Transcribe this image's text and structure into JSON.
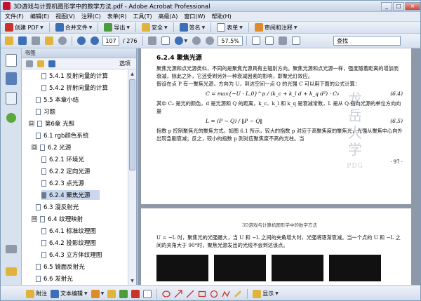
{
  "window": {
    "title": "3D游戏与计算机图形学中的数学方法.pdf - Adobe Acrobat Professional",
    "min": "_",
    "max": "□",
    "close": "×"
  },
  "menu": [
    "文件(F)",
    "编辑(E)",
    "视图(V)",
    "注释(C)",
    "表单(R)",
    "工具(T)",
    "高级(A)",
    "窗口(W)",
    "帮助(H)"
  ],
  "toolbar1": {
    "create_pdf": "创建 PDF",
    "combine": "合并文件",
    "export": "导出",
    "secure": "安全",
    "sign": "签名",
    "forms": "表单",
    "review": "审阅和注释"
  },
  "toolbar2": {
    "page_current": "107",
    "page_total": "/ 276",
    "zoom": "57.5%",
    "find_placeholder": "查找"
  },
  "panel": {
    "title": "书签",
    "options": "选项"
  },
  "tree": [
    {
      "label": "5.4.1 反射向量的计算",
      "level": 3,
      "type": "page"
    },
    {
      "label": "5.4.2 折射向量的计算",
      "level": 3,
      "type": "page"
    },
    {
      "label": "5.5 本章小结",
      "level": 2,
      "type": "page"
    },
    {
      "label": "习题",
      "level": 2,
      "type": "page"
    },
    {
      "label": "第6章 光照",
      "level": 1,
      "type": "expand",
      "sign": "⊟"
    },
    {
      "label": "6.1 rgb颜色系统",
      "level": 2,
      "type": "page"
    },
    {
      "label": "6.2 光源",
      "level": 2,
      "type": "expand",
      "sign": "⊟"
    },
    {
      "label": "6.2.1 环境光",
      "level": 3,
      "type": "page"
    },
    {
      "label": "6.2.2 定向光源",
      "level": 3,
      "type": "page"
    },
    {
      "label": "6.2.3 点光源",
      "level": 3,
      "type": "page"
    },
    {
      "label": "6.2.4 聚焦光源",
      "level": 3,
      "type": "page",
      "selected": true
    },
    {
      "label": "6.3 漫反射光",
      "level": 2,
      "type": "page"
    },
    {
      "label": "6.4 纹理映射",
      "level": 2,
      "type": "expand",
      "sign": "⊟"
    },
    {
      "label": "6.4.1 标准纹理图",
      "level": 3,
      "type": "page"
    },
    {
      "label": "6.4.2 投影纹理图",
      "level": 3,
      "type": "page"
    },
    {
      "label": "6.4.3 立方体纹理图",
      "level": 3,
      "type": "page"
    },
    {
      "label": "6.5 镜面反射光",
      "level": 2,
      "type": "page"
    },
    {
      "label": "6.6 发射光",
      "level": 2,
      "type": "page"
    }
  ],
  "doc": {
    "section": "6.2.4  聚焦光源",
    "para1": "聚焦光源和点光源类似，不同的是聚焦光源具有主辐射方向。聚焦光源和点光源一样，强度随着距离的增加而衰减，除此之外，它还受到另外一种衰减因素的影响，即聚光灯效应。",
    "para2": "假设在点 P 有一聚焦光源，方向为 U，到达空间一点 Q 的光强 C 可以用下面的公式计算：",
    "formula1": "C = max{−U · L,0}^p / (k_c + k_l d + k_q d²) · C₀",
    "eq1": "(6.4)",
    "para3": "其中 C₀ 是光的颜色，d 是光源和 Q 的距离，k_c、k_l 和 k_q 是衰减常数，L 是从 Q 指向光源的单位方向向量",
    "formula2": "L = (P − Q) / ‖P − Q‖",
    "eq2": "(6.5)",
    "para4": "指数 p 控制聚焦光的聚焦方式。如图 6.1 所示，较大的指数 p 对应于高聚焦度的聚焦光，光强从聚焦中心向外出现急剧衰减；反之，较小的指数 p 则对应聚焦度不高的光柱。当",
    "page_number": "· 97 ·",
    "page2_header": "3D游戏与计算机图形学中的数学方法",
    "page2_text": "U = −L 时，聚焦光的光强最大，当 U 和 −L 之间的夹角增大时，光强将逐渐衰减。当一个点的 U 和 −L 之间的夹角大于 90°时，聚焦光源发出的光线不会到达该点。",
    "stamp": [
      "龙",
      "岳",
      "大",
      "学"
    ],
    "stamp_code": "PDG"
  },
  "bottom": {
    "attach": "附注",
    "textedit": "文本编辑",
    "show": "显示"
  }
}
